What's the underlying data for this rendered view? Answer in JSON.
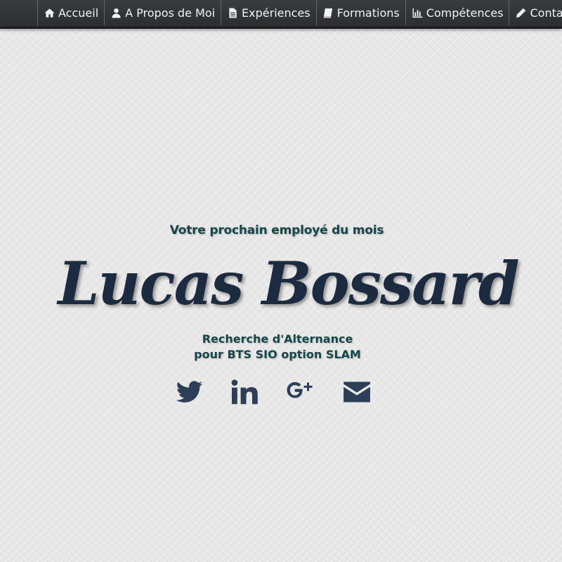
{
  "nav": {
    "items": [
      {
        "label": "Accueil",
        "icon": "home-icon"
      },
      {
        "label": "A Propos de Moi",
        "icon": "user-icon"
      },
      {
        "label": "Expériences",
        "icon": "file-icon"
      },
      {
        "label": "Formations",
        "icon": "book-icon"
      },
      {
        "label": "Compétences",
        "icon": "bar-chart-icon"
      },
      {
        "label": "Contact",
        "icon": "pencil-icon"
      }
    ]
  },
  "hero": {
    "tagline": "Votre prochain employé du mois",
    "name": "Lucas Bossard",
    "subtitle_line1": "Recherche d'Alternance",
    "subtitle_line2": "pour BTS SIO option SLAM"
  },
  "social": {
    "items": [
      "twitter-icon",
      "linkedin-icon",
      "google-plus-icon",
      "email-icon"
    ]
  },
  "colors": {
    "navbar": "#2f3235",
    "heading_dark": "#1d2b40",
    "heading_teal": "#16464a",
    "icon": "#2d3e58",
    "background": "#e7e7e7"
  }
}
